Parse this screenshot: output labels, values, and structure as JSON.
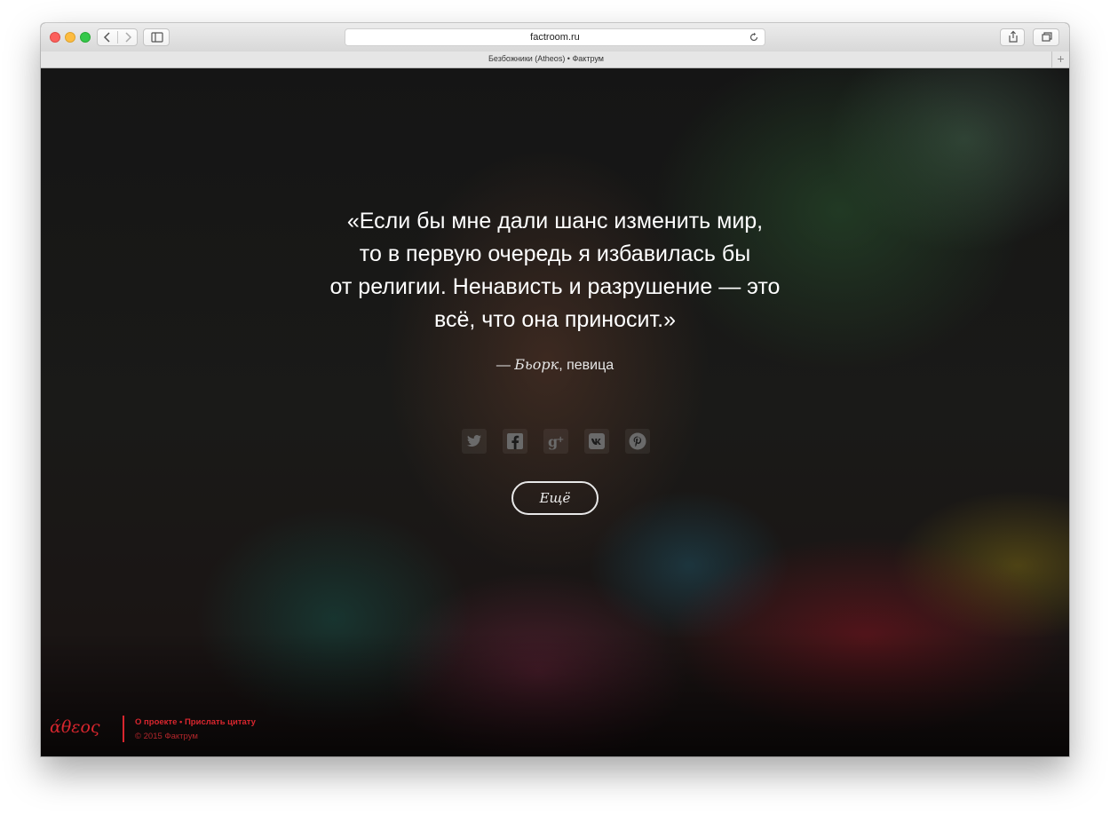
{
  "browser": {
    "url": "factroom.ru",
    "tab_title": "Безбожники (Atheos) • Фактрум",
    "new_tab_symbol": "+"
  },
  "quote": {
    "text": "«Если бы мне дали шанс изменить мир,\nто в первую очередь я избавилась бы\nот религии. Ненависть и разрушение — это\nвсё, что она приносит.»",
    "dash": "— ",
    "author_name": "Бьорк",
    "author_role": ", певица"
  },
  "share": {
    "icons": [
      "twitter-icon",
      "facebook-icon",
      "google-plus-icon",
      "vk-icon",
      "pinterest-icon"
    ]
  },
  "more_button": "Ещё",
  "footer": {
    "logo": "άθεος",
    "about_link": "О проекте",
    "separator": " • ",
    "submit_link": "Прислать цитату",
    "copyright": "© 2015 Фактрум"
  },
  "colors": {
    "accent": "#d9262e",
    "page_background": "#151515"
  }
}
